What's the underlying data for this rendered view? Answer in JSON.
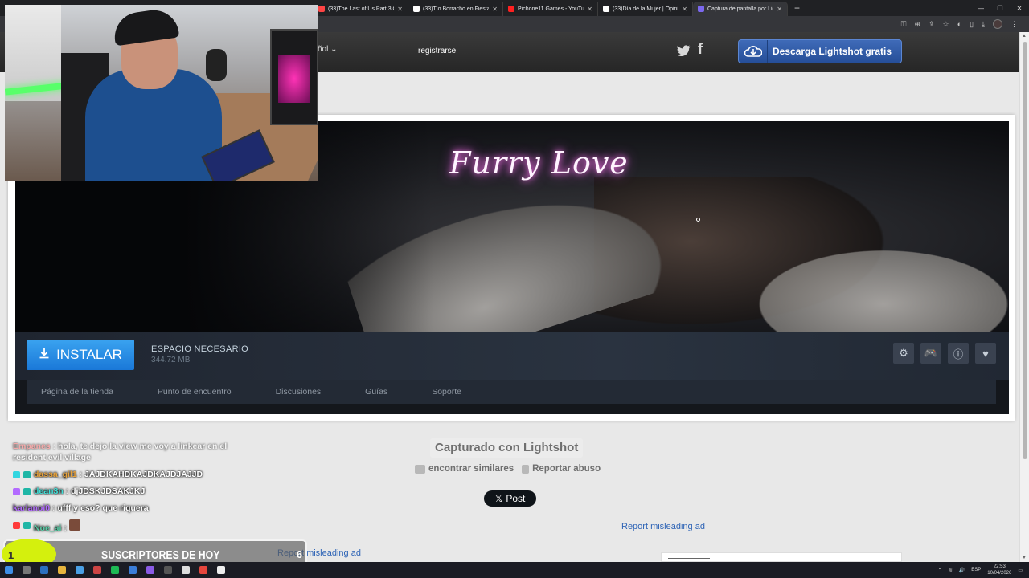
{
  "browser": {
    "tabs": [
      {
        "title": "(33)The Last of Us Part 3 Official T",
        "color": "#ff4444",
        "active": false
      },
      {
        "title": "(33)Tío Borracho en Fiesta de Dic",
        "color": "#ffffff",
        "active": false
      },
      {
        "title": "Pichone11 Games - YouTube",
        "color": "#ff2020",
        "active": false
      },
      {
        "title": "(33)Día de la Mujer | Opiniones D",
        "color": "#ffffff",
        "active": false
      },
      {
        "title": "Captura de pantalla por Lightshot",
        "color": "#7b68ee",
        "active": true
      }
    ],
    "new_tab": "+"
  },
  "header": {
    "language": "ñol",
    "register_label": "registrarse",
    "download_label": "Descarga Lightshot gratis"
  },
  "screenshot": {
    "game_title": "Furry Love",
    "install_label": "INSTALAR",
    "space_label": "ESPACIO NECESARIO",
    "space_value": "344.72 MB",
    "nav": [
      "Página de la tienda",
      "Punto de encuentro",
      "Discusiones",
      "Guías",
      "Soporte"
    ]
  },
  "page": {
    "captured_label": "Capturado con Lightshot",
    "find_similar": "encontrar similares",
    "report_abuse": "Reportar abuso",
    "x_post": "Post",
    "report_ad_1": "Report misleading ad",
    "report_ad_2": "Report misleading ad"
  },
  "chat": [
    {
      "user": "Empanes",
      "user_color": "#ff7777",
      "text": "hola, te dejo la view me voy a linkear en el",
      "text2": "resident evil village",
      "faded": true
    },
    {
      "user": "dassa_gil1",
      "user_color": "#e8a33c",
      "text": "JAJDKAHDKAJDKAJDJAJJD"
    },
    {
      "user": "dean3n",
      "user_color": "#3ee0d8",
      "text": "djJDSKJDSAKJKJ"
    },
    {
      "user": "karlanoi0",
      "user_color": "#b36bff",
      "text": "ufff y eso? que riquera"
    },
    {
      "user": "Noe_ai",
      "user_color": "#58d0a8",
      "text": ""
    }
  ],
  "overlay": {
    "subs_count": "1",
    "subs_label": "SUSCRIPTORES DE HOY",
    "subs_goal": "6"
  },
  "taskbar": {
    "lang": "ESP",
    "time": "22:53",
    "date": "10/04/2026"
  }
}
